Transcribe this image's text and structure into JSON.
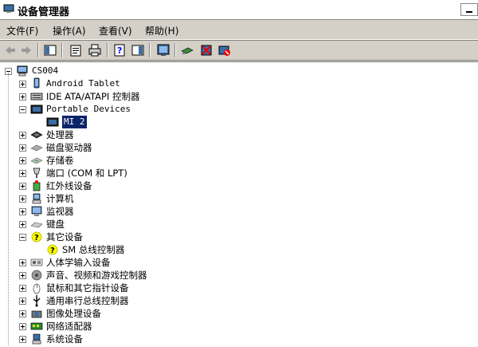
{
  "window": {
    "title": "设备管理器"
  },
  "menu": {
    "file": "文件(F)",
    "action": "操作(A)",
    "view": "查看(V)",
    "help": "帮助(H)"
  },
  "tree": {
    "root": "CS004",
    "items": [
      {
        "label": "Android Tablet",
        "expanded": false,
        "icon": "device-icon"
      },
      {
        "label": "IDE ATA/ATAPI 控制器",
        "expanded": false,
        "icon": "ide-controller-icon"
      },
      {
        "label": "Portable Devices",
        "expanded": true,
        "icon": "portable-device-icon",
        "children": [
          {
            "label": "MI 2",
            "selected": true,
            "icon": "portable-device-icon"
          }
        ]
      },
      {
        "label": "处理器",
        "expanded": false,
        "icon": "processor-icon"
      },
      {
        "label": "磁盘驱动器",
        "expanded": false,
        "icon": "disk-drive-icon"
      },
      {
        "label": "存储卷",
        "expanded": false,
        "icon": "storage-volume-icon"
      },
      {
        "label": "端口 (COM 和 LPT)",
        "expanded": false,
        "icon": "port-icon"
      },
      {
        "label": "红外线设备",
        "expanded": false,
        "icon": "infrared-icon"
      },
      {
        "label": "计算机",
        "expanded": false,
        "icon": "computer-icon"
      },
      {
        "label": "监视器",
        "expanded": false,
        "icon": "monitor-icon"
      },
      {
        "label": "键盘",
        "expanded": false,
        "icon": "keyboard-icon"
      },
      {
        "label": "其它设备",
        "expanded": true,
        "icon": "unknown-device-icon",
        "children": [
          {
            "label": "SM 总线控制器",
            "selected": false,
            "icon": "unknown-device-icon"
          }
        ]
      },
      {
        "label": "人体学输入设备",
        "expanded": false,
        "icon": "hid-icon"
      },
      {
        "label": "声音、视频和游戏控制器",
        "expanded": false,
        "icon": "sound-icon"
      },
      {
        "label": "鼠标和其它指针设备",
        "expanded": false,
        "icon": "mouse-icon"
      },
      {
        "label": "通用串行总线控制器",
        "expanded": false,
        "icon": "usb-icon"
      },
      {
        "label": "图像处理设备",
        "expanded": false,
        "icon": "imaging-icon"
      },
      {
        "label": "网络适配器",
        "expanded": false,
        "icon": "network-adapter-icon"
      },
      {
        "label": "系统设备",
        "expanded": false,
        "icon": "system-device-icon"
      }
    ]
  }
}
